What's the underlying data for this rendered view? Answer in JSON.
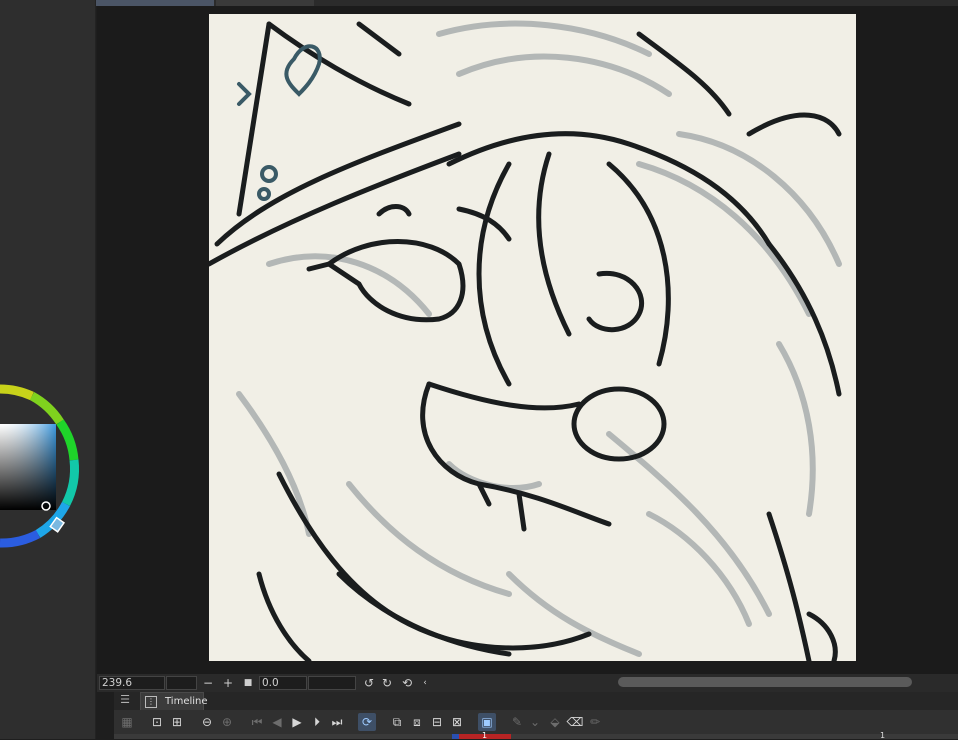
{
  "navigator": {
    "zoom_value": "239.6",
    "rotation_value": "0.0",
    "minus_label": "−",
    "plus_label": "+",
    "stop_label": "■"
  },
  "timeline": {
    "tab_label": "Timeline",
    "current_frame": "1",
    "end_frame": "1"
  },
  "icons": {
    "menu": "menu-icon",
    "timeline_tab": "timeline-tab-icon",
    "zoom_out": "zoom-out-icon",
    "zoom_in": "zoom-in-icon",
    "play": "play-icon",
    "loop": "loop-icon",
    "onion_skin": "onion-skin-icon"
  },
  "colors": {
    "canvas_paper": "#f1efe6",
    "ink": "#1a1d1e",
    "sketch_gray": "#9ea3a3",
    "accent_teal": "#3a5a66",
    "color_square_top": "#4a9edc",
    "timeline_marker": "#b72424"
  }
}
